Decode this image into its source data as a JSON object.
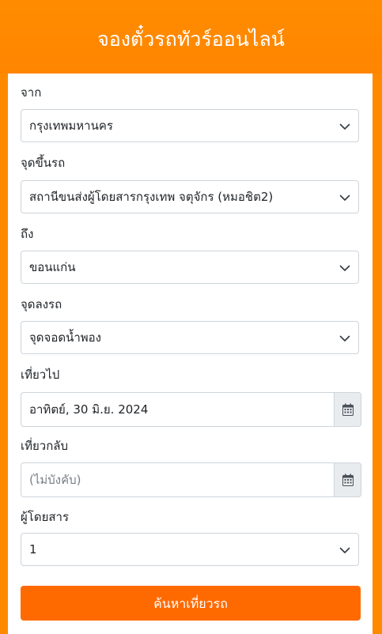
{
  "header": {
    "title": "จองตั๋วรถทัวร์ออนไลน์"
  },
  "form": {
    "from": {
      "label": "จาก",
      "value": "กรุงเทพมหานคร"
    },
    "pickup": {
      "label": "จุดขึ้นรถ",
      "value": "สถานีขนส่งผู้โดยสารกรุงเทพ จตุจักร (หมอชิต2)"
    },
    "to": {
      "label": "ถึง",
      "value": "ขอนแก่น"
    },
    "dropoff": {
      "label": "จุดลงรถ",
      "value": "จุดจอดน้ำพอง"
    },
    "depart": {
      "label": "เที่ยวไป",
      "value": "อาทิตย์, 30 มิ.ย. 2024"
    },
    "return": {
      "label": "เที่ยวกลับ",
      "placeholder": "(ไม่บังคับ)"
    },
    "passengers": {
      "label": "ผู้โดยสาร",
      "value": "1"
    },
    "search_label": "ค้นหาเที่ยวรถ"
  },
  "colors": {
    "header": "#ff8a00",
    "button": "#ff6a00",
    "addon": "#e9ecef"
  },
  "icons": {
    "select_arrow": "chevron-down-icon",
    "date_addon": "calendar-icon"
  }
}
